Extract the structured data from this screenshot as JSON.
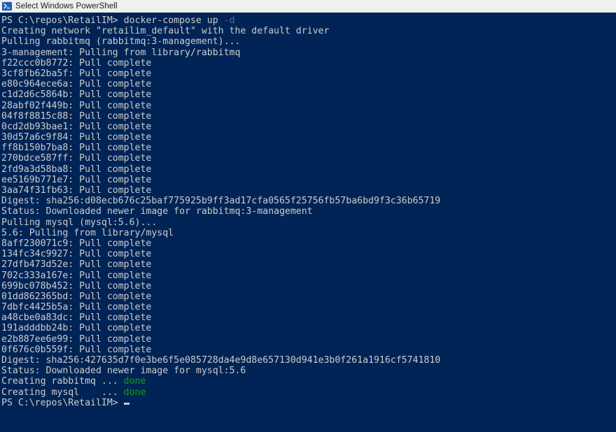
{
  "window": {
    "title": "Select Windows PowerShell",
    "icon": "powershell-prompt-icon"
  },
  "theme": {
    "background": "#012456",
    "foreground": "#cccccc",
    "parameter_color": "#5a6b80",
    "success_color": "#13a10e",
    "titlebar_background": "#f0f0f0",
    "titlebar_foreground": "#1a1a1a"
  },
  "terminal": {
    "prompt": "PS C:\\repos\\RetailIM>",
    "command": "docker-compose up",
    "command_flag": "-d",
    "prompt_final": "PS C:\\repos\\RetailIM>",
    "cursor": "_",
    "lines": [
      "Creating network \"retailim_default\" with the default driver",
      "Pulling rabbitmq (rabbitmq:3-management)...",
      "3-management: Pulling from library/rabbitmq",
      "f22ccc0b8772: Pull complete",
      "3cf8fb62ba5f: Pull complete",
      "e80c964ece6a: Pull complete",
      "c1d2d6c5864b: Pull complete",
      "28abf02f449b: Pull complete",
      "04f8f8815c88: Pull complete",
      "0cd2db93bae1: Pull complete",
      "30d57a6c9f84: Pull complete",
      "ff8b150b7ba8: Pull complete",
      "270bdce587ff: Pull complete",
      "2fd9a3d58ba8: Pull complete",
      "ee5169b771e7: Pull complete",
      "3aa74f31fb63: Pull complete",
      "Digest: sha256:d08ecb676c25baf775925b9ff3ad17cfa0565f25756fb57ba6bd9f3c36b65719",
      "Status: Downloaded newer image for rabbitmq:3-management",
      "Pulling mysql (mysql:5.6)...",
      "5.6: Pulling from library/mysql",
      "8aff230071c9: Pull complete",
      "134fc34c9927: Pull complete",
      "27dfb473d52e: Pull complete",
      "702c333a167e: Pull complete",
      "699bc078b452: Pull complete",
      "01dd862365bd: Pull complete",
      "7dbfc4425b5a: Pull complete",
      "a48cbe0a83dc: Pull complete",
      "191adddbb24b: Pull complete",
      "e2b887ee6e99: Pull complete",
      "0f676c0b559f: Pull complete",
      "Digest: sha256:427635d7f0e3be6f5e085728da4e9d8e657130d941e3b0f261a1916cf5741810",
      "Status: Downloaded newer image for mysql:5.6"
    ],
    "create_results": [
      {
        "label": "Creating rabbitmq ... ",
        "status": "done"
      },
      {
        "label": "Creating mysql    ... ",
        "status": "done"
      }
    ]
  }
}
